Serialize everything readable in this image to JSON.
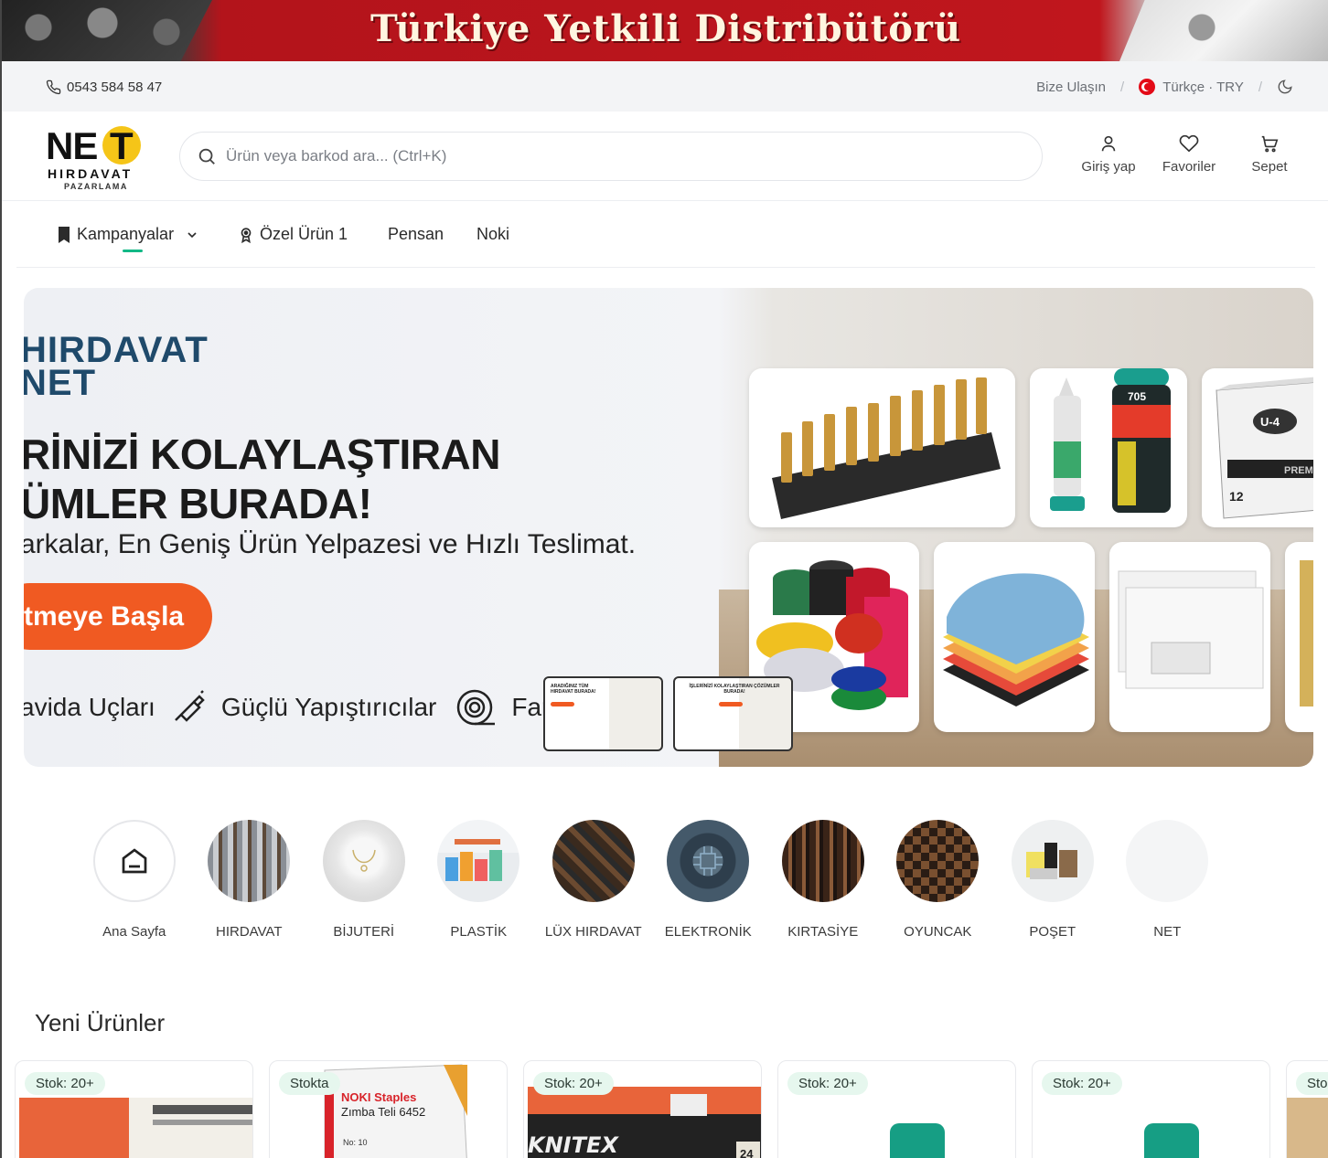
{
  "promo": {
    "text": "Türkiye Yetkili Distribütörü"
  },
  "utility": {
    "phone": "0543 584 58 47",
    "contact": "Bize Ulaşın",
    "language": "Türkçe · TRY",
    "separator": "/"
  },
  "header": {
    "logo": {
      "part1": "NE",
      "part2": "T",
      "line1": "HIRDAVAT",
      "line2": "PAZARLAMA"
    },
    "search_placeholder": "Ürün veya barkod ara... (Ctrl+K)",
    "actions": [
      {
        "label": "Giriş yap",
        "icon": "user-icon"
      },
      {
        "label": "Favoriler",
        "icon": "heart-icon"
      },
      {
        "label": "Sepet",
        "icon": "cart-icon"
      }
    ]
  },
  "nav": {
    "items": [
      {
        "label": "Kampanyalar",
        "icon": "bookmark-icon"
      },
      {
        "label": "Özel Ürün 1",
        "icon": "award-icon"
      },
      {
        "label": "Pensan"
      },
      {
        "label": "Noki"
      }
    ],
    "accent": "#12b886"
  },
  "hero": {
    "brand_line1": "HIRDAVAT",
    "brand_line2": "NET",
    "headline_line1": "RİNİZİ KOLAYLAŞTIRAN",
    "headline_line2": "ÜMLER BURADA!",
    "tagline": "arkalar, En Geniş Ürün Yelpazesi ve Hızlı Teslimat.",
    "cta": "tmeye Başla",
    "features": [
      "avida Uçları",
      "Güçlü Yapıştırıcılar",
      "Far"
    ],
    "tile_text": {
      "can": "705",
      "box": "U-4",
      "box_line": "PREMIUM",
      "box_count": "12"
    },
    "thumbs": [
      {
        "title": "ARADIĞINIZ TÜM HIRDAVAT BURADA!"
      },
      {
        "title": "İŞLERİNİZİ KOLAYLAŞTIRAN ÇÖZÜMLER BURADA!"
      }
    ],
    "cta_color": "#f05a22"
  },
  "categories": [
    {
      "label": "Ana Sayfa"
    },
    {
      "label": "HIRDAVAT"
    },
    {
      "label": "BİJUTERİ"
    },
    {
      "label": "PLASTİK"
    },
    {
      "label": "LÜX HIRDAVAT"
    },
    {
      "label": "ELEKTRONİK"
    },
    {
      "label": "KIRTASİYE"
    },
    {
      "label": "OYUNCAK"
    },
    {
      "label": "POŞET"
    },
    {
      "label": "NET"
    }
  ],
  "new_products": {
    "title": "Yeni Ürünler",
    "items": [
      {
        "badge": "Stok: 20+"
      },
      {
        "badge": "Stokta",
        "brand": "NOKI Staples",
        "name": "Zımba Teli 6452",
        "no": "No: 10"
      },
      {
        "badge": "Stok: 20+",
        "brand": "KNITEX",
        "count": "24"
      },
      {
        "badge": "Stok: 20+"
      },
      {
        "badge": "Stok: 20+"
      },
      {
        "badge": "Sto"
      }
    ]
  }
}
